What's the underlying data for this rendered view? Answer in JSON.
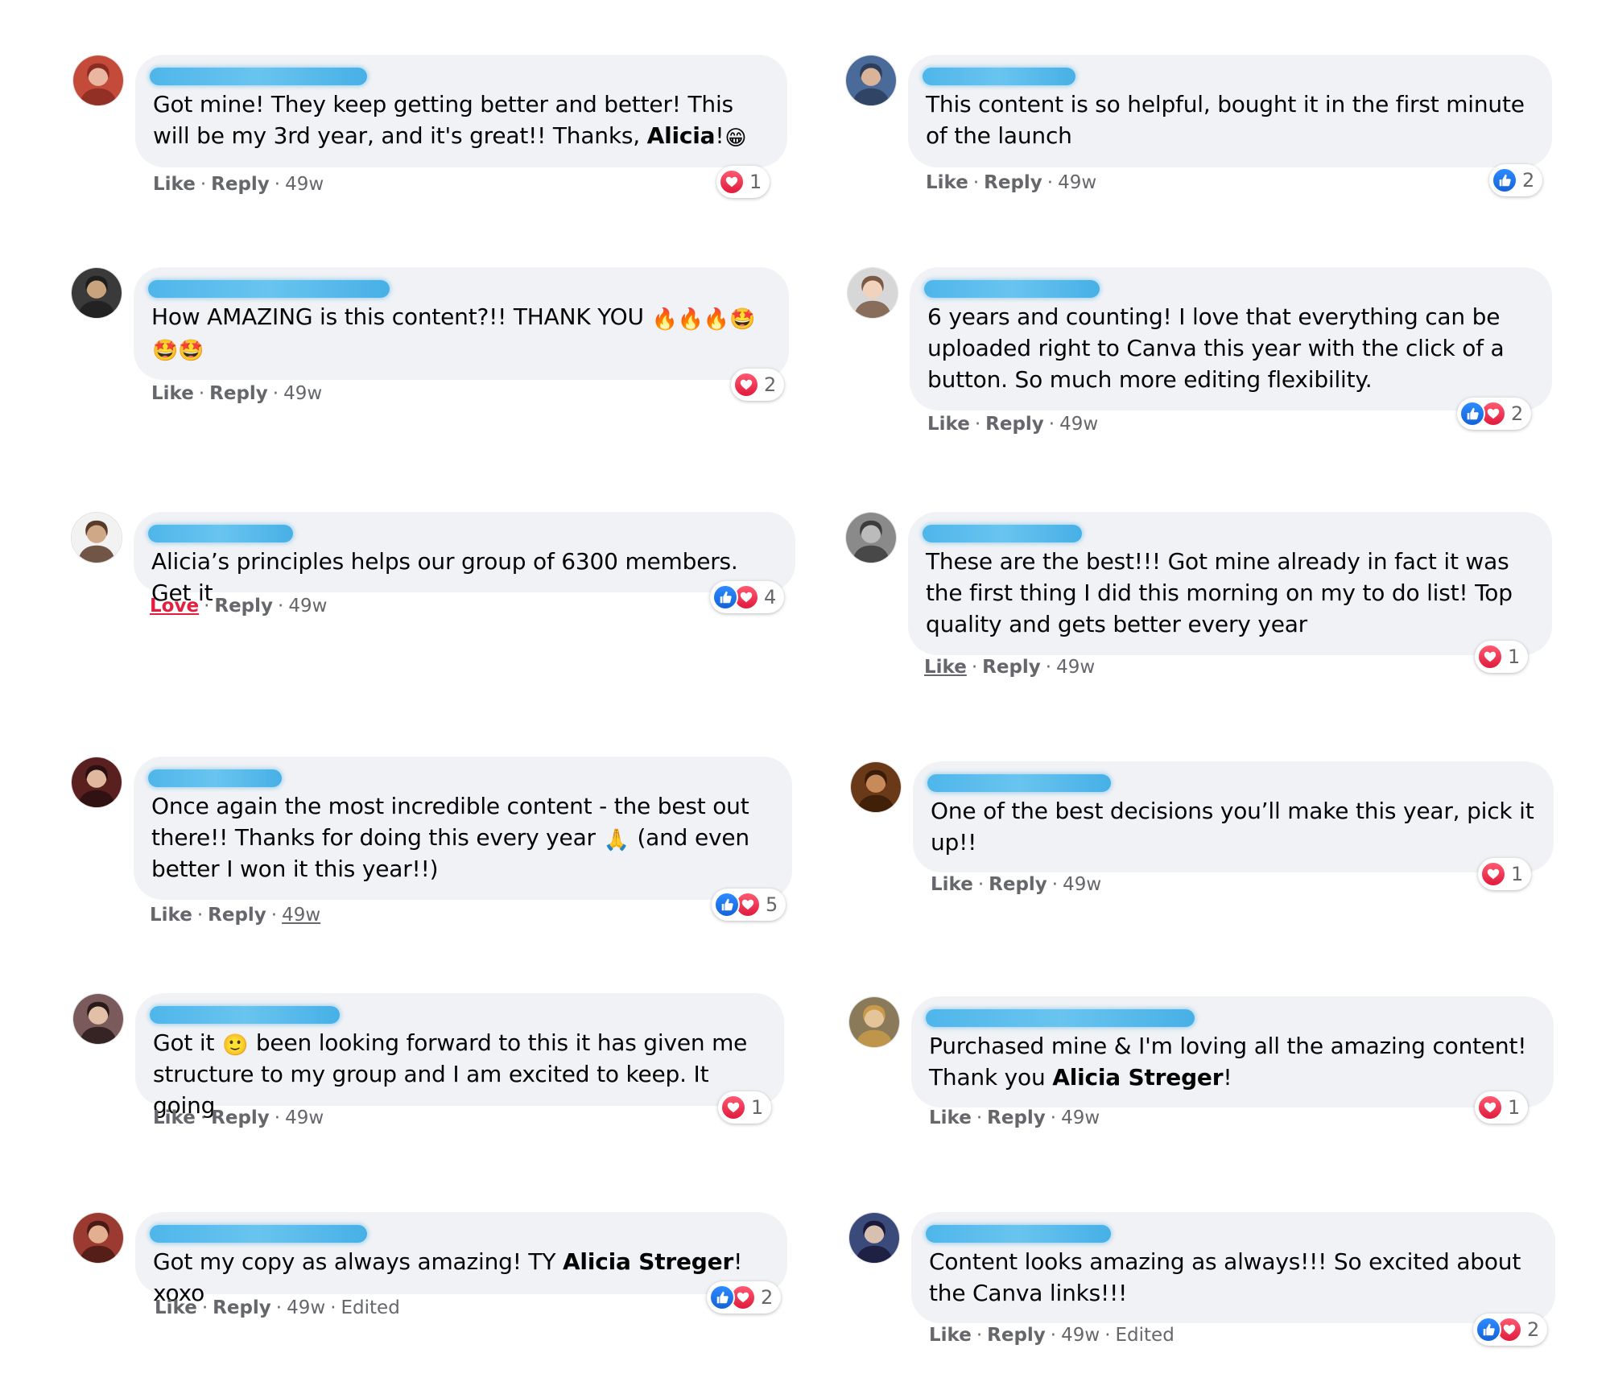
{
  "comments": [
    {
      "text_html": "Got mine! They keep getting better and better! This will be my 3rd year, and it's great!! Thanks, <b>Alicia</b>!<span class='emo'>😁</span>",
      "actions": {
        "like": "Like",
        "reply": "Reply",
        "time": "49w",
        "edited": ""
      },
      "reactions": {
        "types": [
          "love"
        ],
        "count": "1"
      }
    },
    {
      "text_html": "This content is so helpful, bought it in the first minute of the launch",
      "actions": {
        "like": "Like",
        "reply": "Reply",
        "time": "49w",
        "edited": ""
      },
      "reactions": {
        "types": [
          "like"
        ],
        "count": "2"
      }
    },
    {
      "text_html": "How AMAZING is this content?!! THANK YOU <span class='emo'>🔥🔥🔥🤩</span> <span class='emo'>🤩🤩</span>",
      "actions": {
        "like": "Like",
        "reply": "Reply",
        "time": "49w",
        "edited": ""
      },
      "reactions": {
        "types": [
          "love"
        ],
        "count": "2"
      }
    },
    {
      "text_html": "6 years and counting! I love that everything can be uploaded right to Canva this year with the click of a button. So much more editing flexibility.",
      "actions": {
        "like": "Like",
        "reply": "Reply",
        "time": "49w",
        "edited": ""
      },
      "reactions": {
        "types": [
          "like",
          "love"
        ],
        "count": "2"
      }
    },
    {
      "text_html": "Alicia’s principles helps our group of 6300 members. Get it",
      "actions": {
        "like": "Love",
        "reply": "Reply",
        "time": "49w",
        "edited": ""
      },
      "reactions": {
        "types": [
          "like",
          "love"
        ],
        "count": "4"
      }
    },
    {
      "text_html": "These are the best!!! Got mine already in fact it was the first thing I did this morning on my to do list! Top quality and gets better every year",
      "actions": {
        "like": "Like",
        "reply": "Reply",
        "time": "49w",
        "edited": ""
      },
      "reactions": {
        "types": [
          "love"
        ],
        "count": "1"
      }
    },
    {
      "text_html": "Once again the most incredible content - the best out there!! Thanks for doing this every year <span class='emo'>🙏</span> (and even better I won it this year!!)",
      "actions": {
        "like": "Like",
        "reply": "Reply",
        "time": "49w",
        "edited": ""
      },
      "reactions": {
        "types": [
          "like",
          "love"
        ],
        "count": "5"
      }
    },
    {
      "text_html": "One of the best decisions you’ll make this year, pick it up!!",
      "actions": {
        "like": "Like",
        "reply": "Reply",
        "time": "49w",
        "edited": ""
      },
      "reactions": {
        "types": [
          "love"
        ],
        "count": "1"
      }
    },
    {
      "text_html": "Got it <span class='emo'>🙂</span> been looking forward to this it has given me structure to my group and I am excited to keep. It going",
      "actions": {
        "like": "Like",
        "reply": "Reply",
        "time": "49w",
        "edited": ""
      },
      "reactions": {
        "types": [
          "love"
        ],
        "count": "1"
      }
    },
    {
      "text_html": "Purchased mine &amp; I'm loving all the amazing content! Thank you <b>Alicia Streger</b>!",
      "actions": {
        "like": "Like",
        "reply": "Reply",
        "time": "49w",
        "edited": ""
      },
      "reactions": {
        "types": [
          "love"
        ],
        "count": "1"
      }
    },
    {
      "text_html": "Got my copy as always amazing! TY <b>Alicia Streger</b>! xoxo",
      "actions": {
        "like": "Like",
        "reply": "Reply",
        "time": "49w",
        "edited": "Edited"
      },
      "reactions": {
        "types": [
          "like",
          "love"
        ],
        "count": "2"
      }
    },
    {
      "text_html": "Content looks amazing as always!!! So excited about the Canva links!!!",
      "actions": {
        "like": "Like",
        "reply": "Reply",
        "time": "49w",
        "edited": "Edited"
      },
      "reactions": {
        "types": [
          "like",
          "love"
        ],
        "count": "2"
      }
    }
  ],
  "colors": {
    "bubble": "#f0f2f5",
    "redaction": "#5bbdec",
    "like_blue": "#1877f2",
    "love_red": "#e41e3f",
    "meta_gray": "#65676b"
  },
  "icons": [
    "avatar",
    "like-reaction-icon",
    "love-reaction-icon"
  ]
}
